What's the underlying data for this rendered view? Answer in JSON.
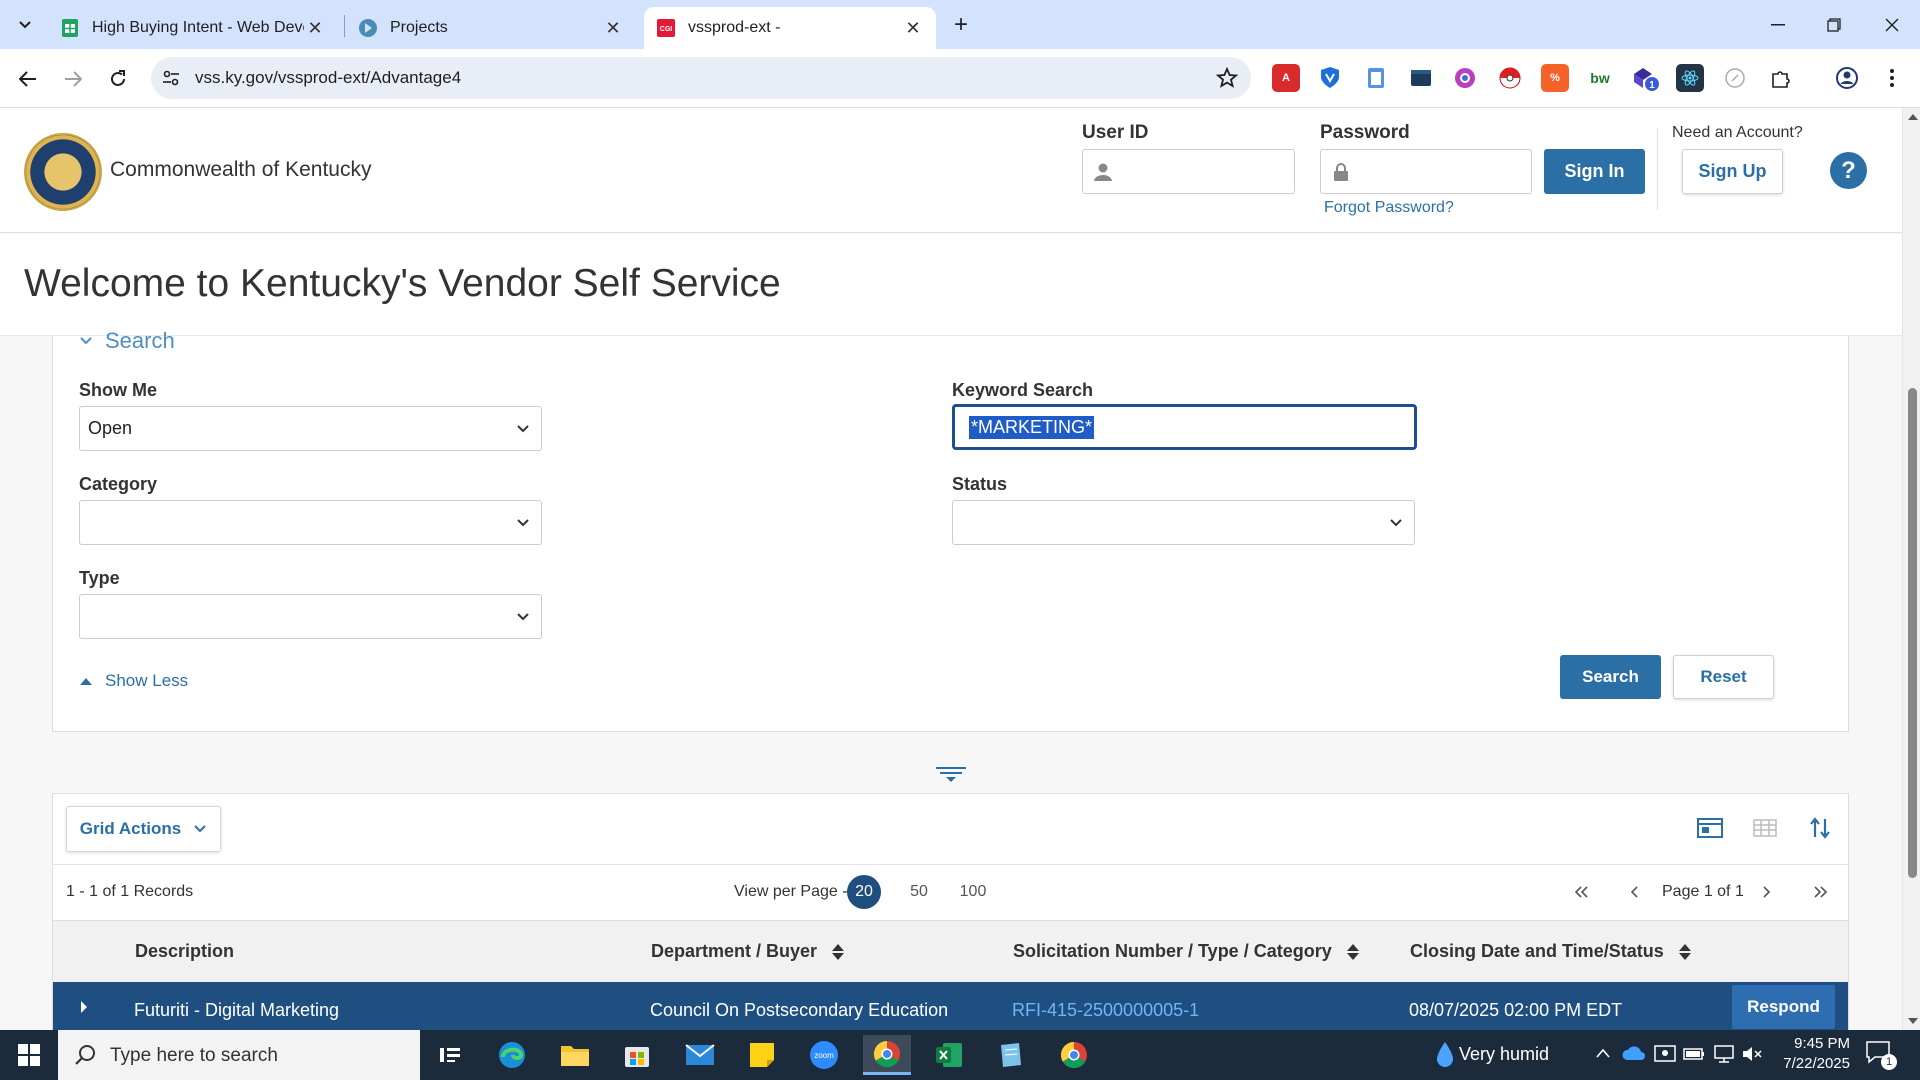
{
  "browser": {
    "tabs": [
      {
        "title": "High Buying Intent - Web Deve",
        "favicon": "sheets-icon"
      },
      {
        "title": "Projects",
        "favicon": "projects-icon"
      },
      {
        "title": "vssprod-ext -",
        "favicon": "cgi-icon"
      }
    ],
    "url": "vss.ky.gov/vssprod-ext/Advantage4",
    "extensions": [
      "acrobat-icon",
      "shield-icon",
      "notes-icon",
      "film-icon",
      "circle-icon",
      "pokeball-icon",
      "percent-icon",
      "bw-icon",
      "cube-icon",
      "react-icon",
      "compass-icon",
      "puzzle-icon"
    ],
    "extension_badge": "1"
  },
  "header": {
    "org_name": "Commonwealth of Kentucky",
    "user_id_label": "User ID",
    "password_label": "Password",
    "sign_in": "Sign In",
    "need_account": "Need an Account?",
    "sign_up": "Sign Up",
    "forgot_password": "Forgot Password?",
    "help": "?"
  },
  "welcome_title": "Welcome to Kentucky's Vendor Self Service",
  "search": {
    "toggle_label": "Search",
    "show_me_label": "Show Me",
    "show_me_value": "Open",
    "keyword_label": "Keyword Search",
    "keyword_value": "*MARKETING*",
    "category_label": "Category",
    "category_value": "",
    "status_label": "Status",
    "status_value": "",
    "type_label": "Type",
    "type_value": "",
    "show_less": "Show Less",
    "search_btn": "Search",
    "reset_btn": "Reset"
  },
  "grid": {
    "actions_label": "Grid Actions",
    "records": "1 - 1 of 1 Records",
    "view_per_page_label": "View per Page -",
    "page_sizes": [
      "20",
      "50",
      "100"
    ],
    "active_page_size": "20",
    "page_label": "Page 1 of 1",
    "columns": [
      "Description",
      "Department / Buyer",
      "Solicitation Number / Type / Category",
      "Closing Date and Time/Status"
    ],
    "rows": [
      {
        "description": "Futuriti - Digital Marketing",
        "department": "Council On Postsecondary Education",
        "solicitation": "RFI-415-2500000005-1",
        "closing": "08/07/2025 02:00 PM EDT",
        "action": "Respond"
      }
    ]
  },
  "taskbar": {
    "search_placeholder": "Type here to search",
    "weather": "Very humid",
    "time": "9:45 PM",
    "date": "7/22/2025",
    "notification_count": "1"
  },
  "colors": {
    "brand_blue": "#2a6fa6",
    "row_highlight": "#1e4f80",
    "tab_bar": "#d3e3fd"
  }
}
